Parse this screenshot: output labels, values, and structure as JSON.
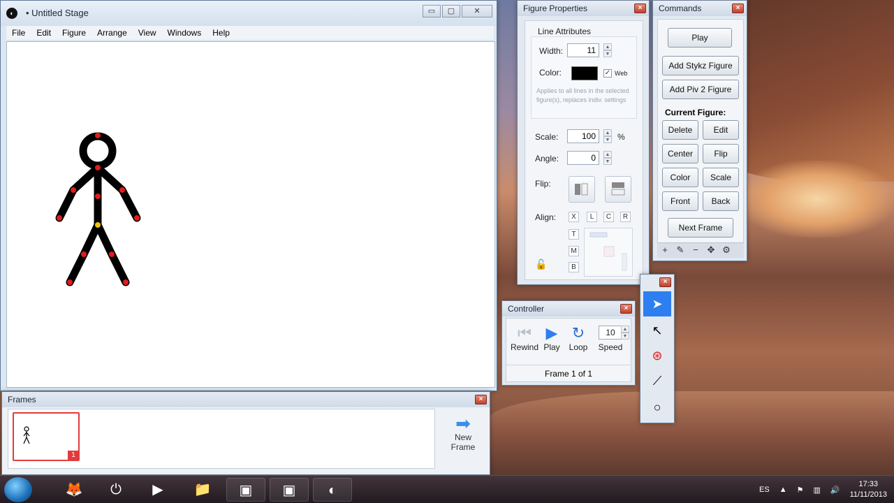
{
  "stage_window": {
    "title": "• Untitled Stage",
    "app_icon": "pivot-logo-icon",
    "controls": {
      "minimize": "▭",
      "maximize": "▢",
      "close": "✕"
    },
    "menu": [
      "File",
      "Edit",
      "Figure",
      "Arrange",
      "View",
      "Windows",
      "Help"
    ]
  },
  "frames_window": {
    "title": "Frames",
    "frame_number": "1",
    "new_frame_label_1": "New",
    "new_frame_label_2": "Frame"
  },
  "figure_properties": {
    "title": "Figure Properties",
    "line_attributes": "Line Attributes",
    "width_label": "Width:",
    "width_value": "11",
    "color_label": "Color:",
    "color_value": "#000000",
    "web_label": "Web",
    "web_checked": "✓",
    "hint": "Applies to all lines in the selected figure(s), replaces indiv. settings",
    "scale_label": "Scale:",
    "scale_value": "100",
    "scale_unit": "%",
    "angle_label": "Angle:",
    "angle_value": "0",
    "flip_label": "Flip:",
    "align_label": "Align:",
    "align_h": [
      "X",
      "L",
      "C",
      "R"
    ],
    "align_v": [
      "T",
      "M",
      "B"
    ]
  },
  "commands": {
    "title": "Commands",
    "play": "Play",
    "add_stykz": "Add Stykz Figure",
    "add_piv2": "Add Piv 2 Figure",
    "current_figure": "Current Figure:",
    "delete": "Delete",
    "edit": "Edit",
    "center": "Center",
    "flip": "Flip",
    "color": "Color",
    "scale": "Scale",
    "front": "Front",
    "back": "Back",
    "next_frame": "Next Frame",
    "toolbar": [
      "+",
      "✎",
      "−",
      "✥",
      "⚙"
    ]
  },
  "controller": {
    "title": "Controller",
    "rewind": "Rewind",
    "play": "Play",
    "loop": "Loop",
    "speed_label": "Speed",
    "speed_value": "10",
    "frame_status": "Frame 1 of 1"
  },
  "taskbar": {
    "language": "ES",
    "time": "17:33",
    "date": "11/11/2013"
  },
  "colors": {
    "accent_blue": "#2d7ff0",
    "frame_selected": "#e23b3b",
    "joint_red": "#e21b1b",
    "joint_yellow": "#f0c400"
  }
}
